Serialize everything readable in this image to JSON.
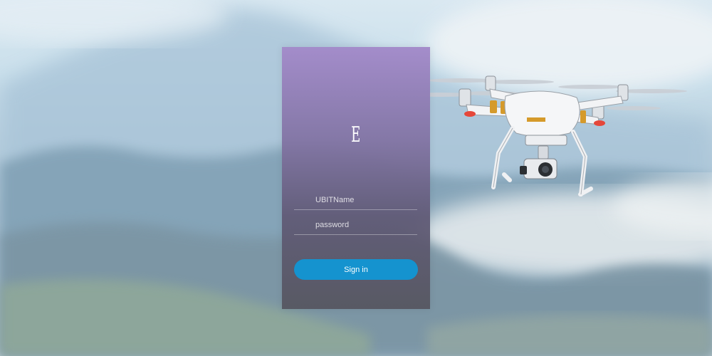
{
  "login": {
    "logo_text": "E",
    "username_placeholder": "UBITName",
    "password_placeholder": "password",
    "signin_label": "Sign in"
  },
  "colors": {
    "button": "#1593cf",
    "card_top": "#a38bca",
    "card_bottom": "#565660"
  },
  "icons": {
    "drone": "quadcopter-drone-image"
  }
}
